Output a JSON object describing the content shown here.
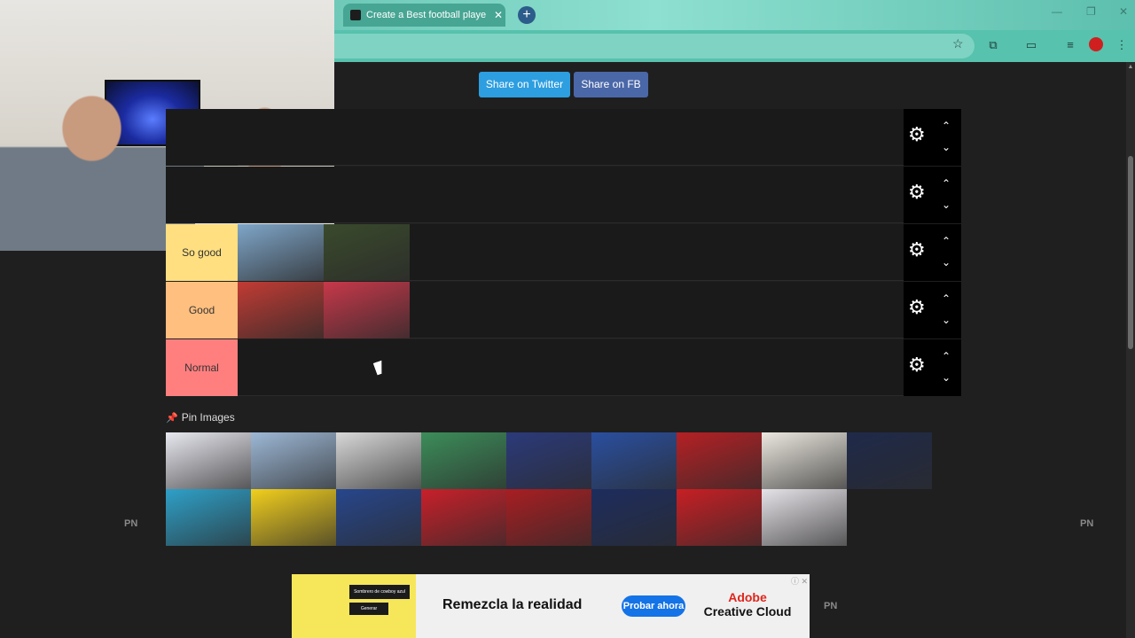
{
  "browser": {
    "tab_title": "Create a Best football players T",
    "tab_close": "✕",
    "new_tab": "+",
    "window_controls": [
      "—",
      "❐",
      "✕"
    ]
  },
  "page": {
    "share_twitter": "Share on Twitter",
    "share_fb": "Share on FB",
    "tiers": [
      {
        "label": "",
        "color": "#1a1a1a",
        "items": []
      },
      {
        "label": "",
        "color": "#1a1a1a",
        "items": []
      },
      {
        "label": "So good",
        "color": "#ffdf80",
        "items": [
          "#7fa6c9",
          "#3a4a2c"
        ]
      },
      {
        "label": "Good",
        "color": "#ffbf7f",
        "items": [
          "#c23b34",
          "#c7384a"
        ]
      },
      {
        "label": "Normal",
        "color": "#ff7f7f",
        "items": []
      }
    ],
    "pin_label": "Pin Images",
    "pool": [
      "#e8e8f0",
      "#9db8d6",
      "#d8d8d8",
      "#3c8d5a",
      "#2b3a7a",
      "#2a4fa0",
      "#b52024",
      "#ece8e0",
      "#1f2a4a",
      "#2ea0c8",
      "#f2cf1d",
      "#27468c",
      "#c8202a",
      "#a81e22",
      "#1d2c5e",
      "#c71f24",
      "#e6e3e8"
    ],
    "watermark": "PN"
  },
  "ad": {
    "box_text": "Sombrero de cowboy azul",
    "btn_text": "Generar",
    "headline": "Remezcla la realidad",
    "cta": "Probar ahora",
    "brand_line1": "Adobe",
    "brand_line2": "Creative Cloud",
    "close": "ⓘ ✕",
    "side": "PN"
  }
}
